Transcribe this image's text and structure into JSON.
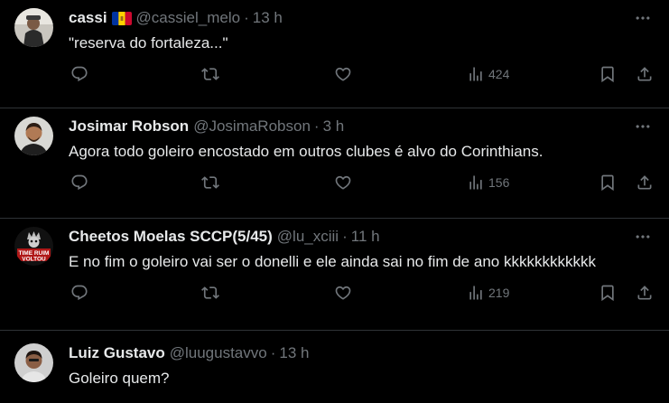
{
  "tweets": [
    {
      "name": "cassi",
      "handle": "@cassiel_melo",
      "dot": "·",
      "time": "13 h",
      "text": "\"reserva do fortaleza...\"",
      "views": "424",
      "flag_colors": [
        "#0033a0",
        "#ffd200",
        "#cc092f"
      ]
    },
    {
      "name": "Josimar Robson",
      "handle": "@JosimaRobson",
      "dot": "·",
      "time": "3 h",
      "text": "Agora todo goleiro encostado em outros clubes é alvo do Corinthians.",
      "views": "156"
    },
    {
      "name": "Cheetos Moelas SCCP(5/45)",
      "handle": "@lu_xciii",
      "dot": "·",
      "time": "11 h",
      "text": "E no fim o goleiro vai ser o donelli e ele ainda sai no fim de ano kkkkkkkkkkkk",
      "views": "219"
    },
    {
      "name": "Luiz Gustavo",
      "handle": "@luugustavvo",
      "dot": "·",
      "time": "13 h",
      "text": "Goleiro quem?"
    }
  ],
  "avatar3_logo": "TIME RUIM VOLTOU",
  "icons": [
    "reply-icon",
    "retweet-icon",
    "like-icon",
    "views-icon",
    "bookmark-icon",
    "share-icon",
    "more-icon"
  ],
  "colors": {
    "background": "#000000",
    "text": "#e7e9ea",
    "muted": "#71767b",
    "divider": "#2f3336"
  }
}
